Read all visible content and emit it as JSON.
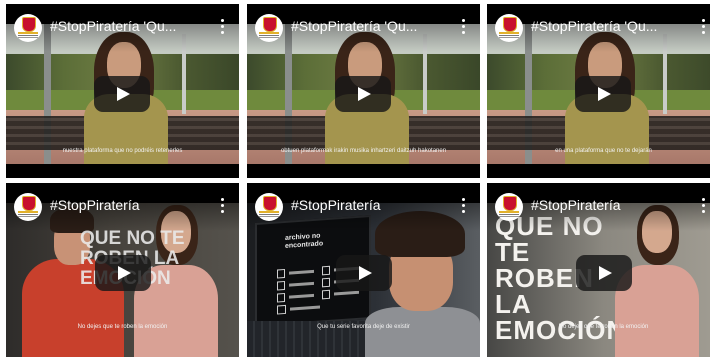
{
  "colors": {
    "player_bg": "#000000",
    "play_button_bg": "#171717",
    "title_text": "#ffffff"
  },
  "icons": {
    "channel_avatar": "spain-government-crest-icon",
    "menu": "kebab-menu-icon",
    "play": "play-icon"
  },
  "videos": [
    {
      "title": "#StopPiratería 'Qu...",
      "subtitle": "nuestra plataforma que no podréis retenerles"
    },
    {
      "title": "#StopPiratería 'Qu...",
      "subtitle": "obtuen plataformak irakin musika inhartzeri daitzuh hakotanen"
    },
    {
      "title": "#StopPiratería 'Qu...",
      "subtitle": "en una plataforma que no te dejarán"
    },
    {
      "title": "#StopPiratería",
      "subtitle": "No dejes que te roben la emoción",
      "overlay_text": "QUE NO TE ROBEN LA EMOCIÓN"
    },
    {
      "title": "#StopPiratería",
      "subtitle": "Que tu serie favorita deje de existir",
      "screen_text": "archivo no encontrado"
    },
    {
      "title": "#StopPiratería",
      "subtitle": "No dejes que te roben la emoción",
      "poster_text": "QUE NO TE ROBEN LA EMOCIÓN"
    }
  ]
}
